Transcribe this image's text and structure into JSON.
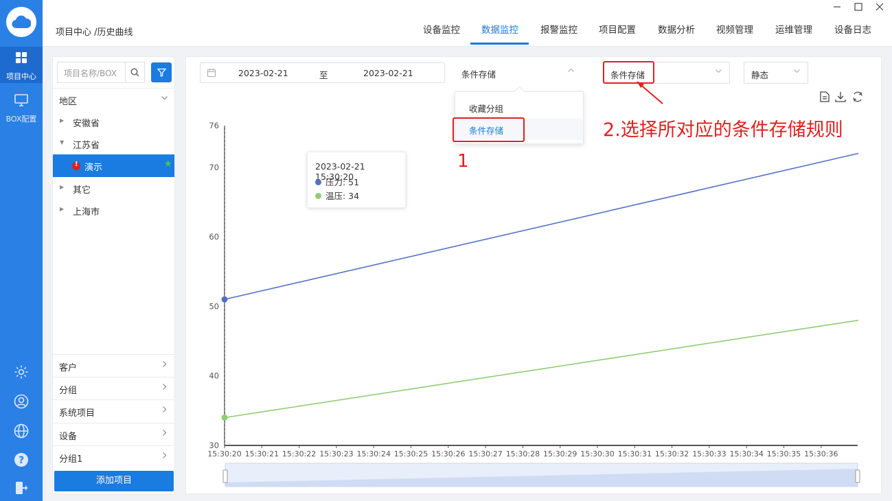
{
  "app": {
    "rail": [
      {
        "label": "项目中心",
        "active": true
      },
      {
        "label": "BOX配置",
        "active": false
      }
    ],
    "rail_bottom_icons": [
      "settings-icon",
      "user-icon",
      "globe-icon",
      "help-icon",
      "logout-icon"
    ]
  },
  "header": {
    "breadcrumb": "项目中心 /历史曲线",
    "nav": [
      "设备监控",
      "数据监控",
      "报警监控",
      "项目配置",
      "数据分析",
      "视频管理",
      "运维管理",
      "设备日志"
    ],
    "active_nav": "数据监控",
    "window_controls": [
      "minimize-icon",
      "maximize-icon",
      "close-icon"
    ]
  },
  "sidebar": {
    "search_placeholder": "项目名称/BOX",
    "region_label": "地区",
    "tree": [
      {
        "label": "安徽省",
        "expanded": false
      },
      {
        "label": "江苏省",
        "expanded": true
      },
      {
        "label": "演示",
        "selected": true,
        "child": true
      },
      {
        "label": "其它",
        "expanded": false
      },
      {
        "label": "上海市",
        "expanded": false
      }
    ],
    "sections": [
      "客户",
      "分组",
      "系统项目",
      "设备",
      "分组1"
    ],
    "add_button": "添加项目"
  },
  "toolbar": {
    "date_start": "2023-02-21",
    "date_sep": "至",
    "date_end": "2023-02-21",
    "mode_select": "条件存储",
    "rule_select": "条件存储",
    "type_select": "静态",
    "dropdown_options": [
      "收藏分组",
      "条件存储"
    ],
    "dropdown_selected": "条件存储"
  },
  "annotations": {
    "step1": "1",
    "step2": "2.选择所对应的条件存储规则"
  },
  "tooltip": {
    "time": "2023-02-21 15:30:20",
    "series1": "压力: 51",
    "series2": "温压: 34"
  },
  "colors": {
    "accent": "#1a7be0",
    "series1": "#5470c6",
    "series2": "#91cc75",
    "annotation": "#e02020"
  },
  "chart_data": {
    "type": "line",
    "x": [
      "15:30:20",
      "15:30:21",
      "15:30:22",
      "15:30:23",
      "15:30:24",
      "15:30:25",
      "15:30:26",
      "15:30:27",
      "15:30:28",
      "15:30:29",
      "15:30:30",
      "15:30:31",
      "15:30:32",
      "15:30:33",
      "15:30:34",
      "15:30:35",
      "15:30:36"
    ],
    "series": [
      {
        "name": "压力",
        "x_start": "15:30:20",
        "y_start": 51,
        "x_end": "15:30:37",
        "y_end": 72,
        "color": "#5470c6"
      },
      {
        "name": "温压",
        "x_start": "15:30:20",
        "y_start": 34,
        "x_end": "15:30:37",
        "y_end": 48,
        "color": "#91cc75"
      }
    ],
    "y_ticks": [
      30,
      40,
      50,
      60,
      70,
      76
    ],
    "ylim": [
      30,
      76
    ],
    "grid": false,
    "legend": "none"
  }
}
